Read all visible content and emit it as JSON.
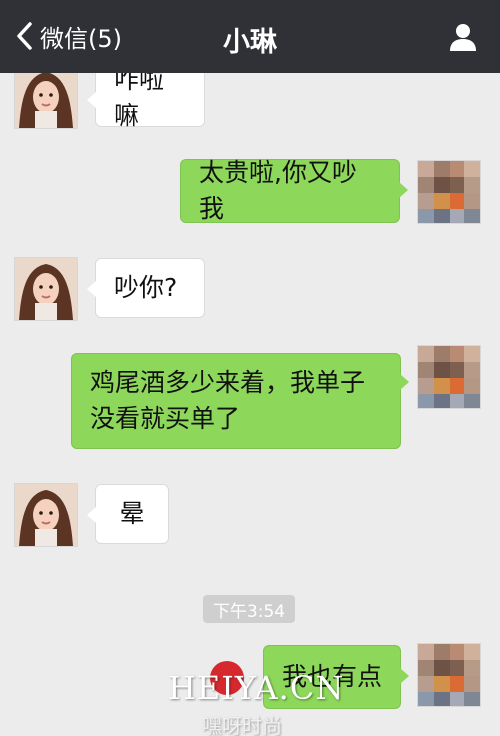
{
  "header": {
    "back_label": "微信(5)",
    "title": "小琳"
  },
  "messages": [
    {
      "side": "left",
      "text": "咋啦嘛"
    },
    {
      "side": "right",
      "text": "太贵啦,你又吵我"
    },
    {
      "side": "left",
      "text": "吵你?"
    },
    {
      "side": "right",
      "text_line1": "鸡尾酒多少来着，我单子",
      "text_line2": "没看就买单了"
    },
    {
      "side": "left",
      "text": "晕"
    },
    {
      "side": "right",
      "text": "我也有点"
    }
  ],
  "timestamp": "下午3:54",
  "watermark": {
    "text": "HEIYA.CN",
    "subtext": "嘿呀时尚"
  },
  "colors": {
    "header_bg": "#2f3136",
    "chat_bg": "#ececec",
    "incoming_bubble": "#ffffff",
    "outgoing_bubble": "#8dd75a"
  },
  "icons": {
    "back": "chevron-left-icon",
    "contact": "person-icon"
  }
}
